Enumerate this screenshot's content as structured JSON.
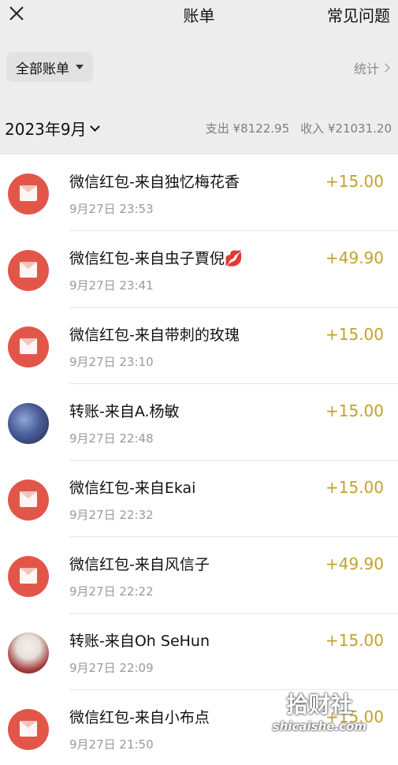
{
  "header": {
    "title": "账单",
    "faq_label": "常见问题",
    "close_icon": "close-icon"
  },
  "filter": {
    "all_bills_label": "全部账单",
    "stats_label": "统计"
  },
  "summary": {
    "month": "2023年9月",
    "expense": "支出 ¥8122.95",
    "income": "收入 ¥21031.20"
  },
  "transactions": [
    {
      "title": "微信红包-来自独忆梅花香",
      "time": "9月27日 23:53",
      "amount": "+15.00",
      "icon": "red-packet-icon"
    },
    {
      "title": "微信红包-来自虫子賈倪💋",
      "time": "9月27日 23:41",
      "amount": "+49.90",
      "icon": "red-packet-icon"
    },
    {
      "title": "微信红包-来自带刺的玫瑰",
      "time": "9月27日 23:10",
      "amount": "+15.00",
      "icon": "red-packet-icon"
    },
    {
      "title": "转账-来自A.杨敏",
      "time": "9月27日 22:48",
      "amount": "+15.00",
      "icon": "user-avatar"
    },
    {
      "title": "微信红包-来自Ekai",
      "time": "9月27日 22:32",
      "amount": "+15.00",
      "icon": "red-packet-icon"
    },
    {
      "title": "微信红包-来自风信子",
      "time": "9月27日 22:22",
      "amount": "+49.90",
      "icon": "red-packet-icon"
    },
    {
      "title": "转账-来自Oh SeHun",
      "time": "9月27日 22:09",
      "amount": "+15.00",
      "icon": "user-avatar"
    },
    {
      "title": "微信红包-来自小布点",
      "time": "9月27日 21:50",
      "amount": "+15.00",
      "icon": "red-packet-icon"
    }
  ],
  "watermark": {
    "text": "拾财社",
    "domain": "shicaishe.com"
  },
  "colors": {
    "background": "#ededed",
    "amount_gold": "#c2a229",
    "red_packet": "#e2564a"
  }
}
